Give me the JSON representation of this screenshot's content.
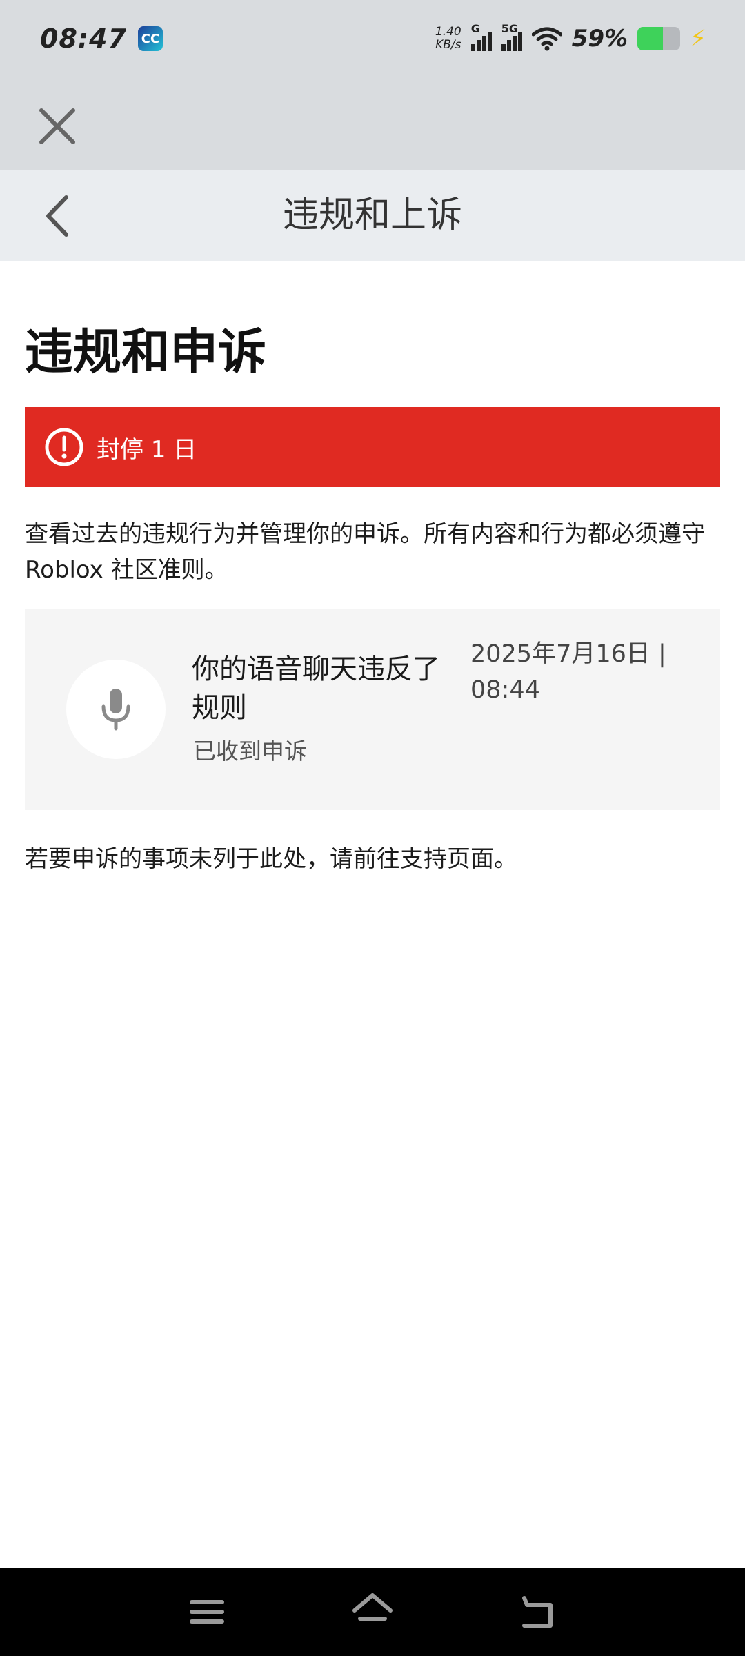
{
  "status_bar": {
    "time": "08:47",
    "app_icon_label": "CC",
    "net_speed_value": "1.40",
    "net_speed_unit": "KB/s",
    "signal1_label": "G",
    "signal2_label": "5G",
    "battery_percent": "59%",
    "battery_level": 0.59,
    "charging_color": "#f2c514"
  },
  "header": {
    "title": "违规和上诉"
  },
  "main": {
    "page_title": "违规和申诉",
    "alert": {
      "text": "封停 1 日",
      "color": "#e02a22"
    },
    "description": "查看过去的违规行为并管理你的申诉。所有内容和行为都必须遵守 Roblox 社区准则。",
    "violation_card": {
      "icon": "microphone-icon",
      "title": "你的语音聊天违反了规则",
      "status": "已收到申诉",
      "date": "2025年7月16日 | 08:44"
    },
    "footer_note": "若要申诉的事项未列于此处，请前往支持页面。"
  },
  "nav_bar": {
    "menu_icon": "menu-icon",
    "home_icon": "home-icon",
    "back_icon": "back-arrow-icon"
  }
}
